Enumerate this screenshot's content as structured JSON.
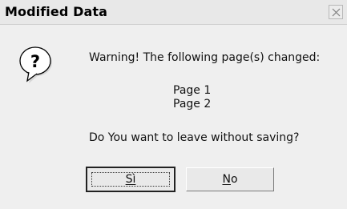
{
  "window": {
    "title": "Modified Data"
  },
  "message": {
    "warning": "Warning! The following page(s) changed:",
    "pages": [
      "Page 1",
      "Page 2"
    ],
    "question": "Do You want to leave without saving?"
  },
  "buttons": {
    "yes": {
      "mnemonic": "S",
      "rest": "ì",
      "label": "Sì"
    },
    "no": {
      "mnemonic": "N",
      "rest": "o",
      "label": "No"
    }
  },
  "icons": {
    "dialog": "question-icon",
    "close": "close-icon"
  },
  "colors": {
    "titlebar": "#e8e8e8",
    "dialog_bg": "#efefef",
    "icon_fill": "#ffffff",
    "icon_stroke": "#000000"
  }
}
